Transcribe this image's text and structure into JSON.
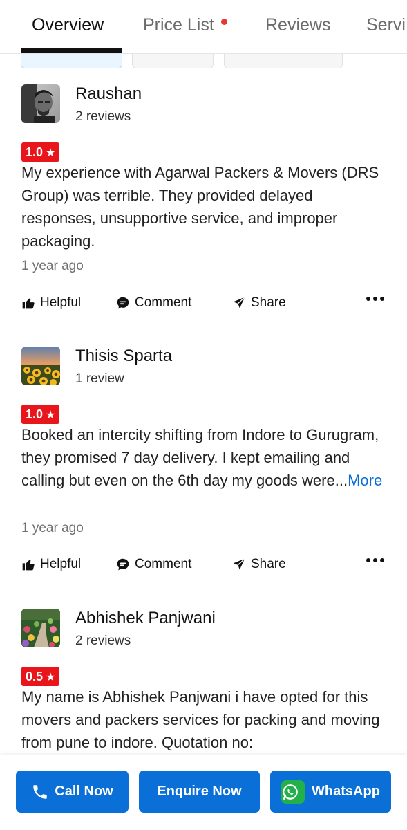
{
  "tabs": [
    {
      "label": "Overview",
      "active": true
    },
    {
      "label": "Price List",
      "has_dot": true
    },
    {
      "label": "Reviews"
    },
    {
      "label": "Servi"
    }
  ],
  "reviews": [
    {
      "name": "Raushan",
      "count": "2 reviews",
      "rating": "1.0",
      "text": "My experience with Agarwal Packers & Movers (DRS Group) was terrible. They provided delayed responses, unsupportive service, and improper packaging.",
      "more": "",
      "time": "1 year ago",
      "avatar": "portrait-photo"
    },
    {
      "name": "Thisis Sparta",
      "count": "1 review",
      "rating": "1.0",
      "text": "Booked an intercity shifting from Indore to Gurugram, they promised 7 day delivery. I kept emailing and calling but even on the 6th day my goods were...",
      "more": "More",
      "time": "1 year ago",
      "avatar": "sunflower-field-photo"
    },
    {
      "name": "Abhishek Panjwani",
      "count": "2 reviews",
      "rating": "0.5",
      "text": "My name is Abhishek Panjwani i have opted for this movers and packers services for packing and moving from pune to indore. Quotation no:",
      "more": "",
      "time": "",
      "avatar": "garden-path-photo"
    }
  ],
  "actions": {
    "helpful": "Helpful",
    "comment": "Comment",
    "share": "Share"
  },
  "bottom_bar": {
    "call": "Call Now",
    "enquire": "Enquire Now",
    "whatsapp": "WhatsApp"
  },
  "colors": {
    "rating_bg": "#e8151b",
    "button_bg": "#0a6fd6",
    "link": "#0a6dd6",
    "whatsapp_green": "#22b04b"
  },
  "icons": [
    "thumbs-up-icon",
    "comment-icon",
    "share-icon",
    "more-icon",
    "phone-icon",
    "whatsapp-icon",
    "star-icon"
  ]
}
